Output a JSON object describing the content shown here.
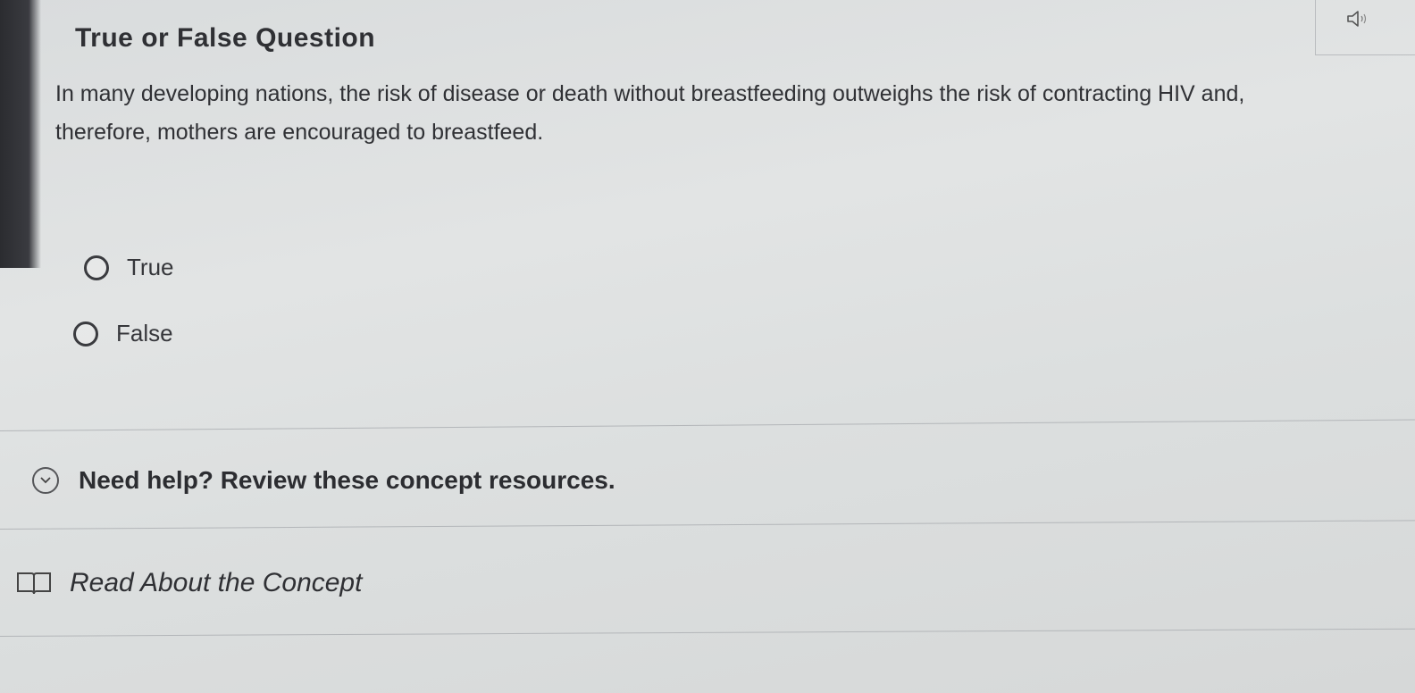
{
  "question": {
    "title": "True or False Question",
    "text": "In many developing nations, the risk of disease or death without breastfeeding outweighs the risk of contracting HIV and, therefore, mothers are encouraged to breastfeed.",
    "options": [
      {
        "label": "True",
        "selected": false
      },
      {
        "label": "False",
        "selected": false
      }
    ]
  },
  "audio": {
    "icon": "speaker-icon"
  },
  "help": {
    "label": "Need help? Review these concept resources.",
    "icon": "chevron-down-icon"
  },
  "resources": [
    {
      "label": "Read About the Concept",
      "icon": "book-icon"
    }
  ]
}
